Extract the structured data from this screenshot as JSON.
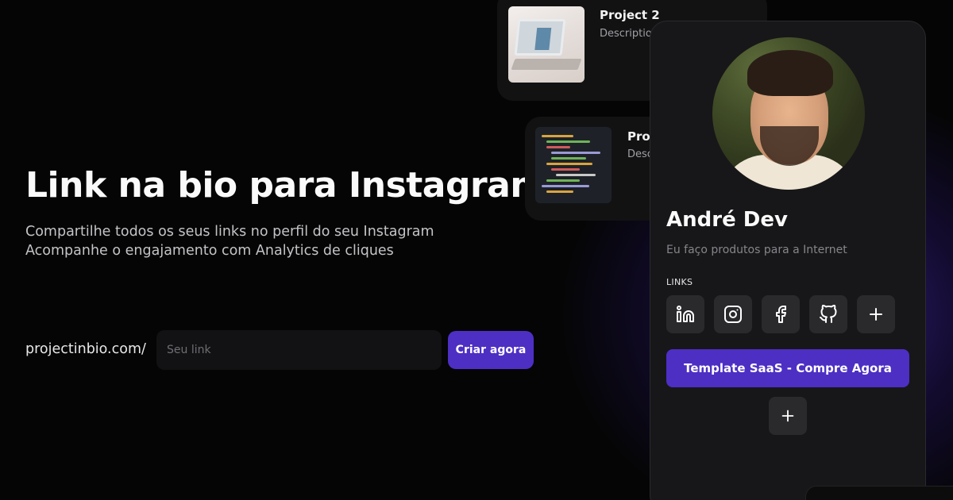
{
  "hero": {
    "title": "Link na bio para Instagram",
    "subtitle_line1": "Compartilhe todos os seus links no perfil do seu Instagram",
    "subtitle_line2": "Acompanhe o engajamento com Analytics de cliques"
  },
  "signup": {
    "url_prefix": "projectinbio.com/",
    "input_placeholder": "Seu link",
    "input_value": "",
    "button_label": "Criar agora"
  },
  "projects": [
    {
      "title": "Project 2",
      "description": "Description"
    },
    {
      "title": "Proj",
      "description": "Desc"
    }
  ],
  "profile": {
    "name": "André Dev",
    "bio": "Eu faço produtos para a Internet",
    "links_label": "LINKS",
    "social_icons": [
      "linkedin-icon",
      "instagram-icon",
      "facebook-icon",
      "github-icon",
      "plus-icon"
    ],
    "cta_label": "Template SaaS - Compre Agora"
  },
  "colors": {
    "background": "#050505",
    "accent": "#4d2fc4",
    "card": "#121213",
    "phone": "#171719",
    "icon_button": "#2a2a2d"
  }
}
